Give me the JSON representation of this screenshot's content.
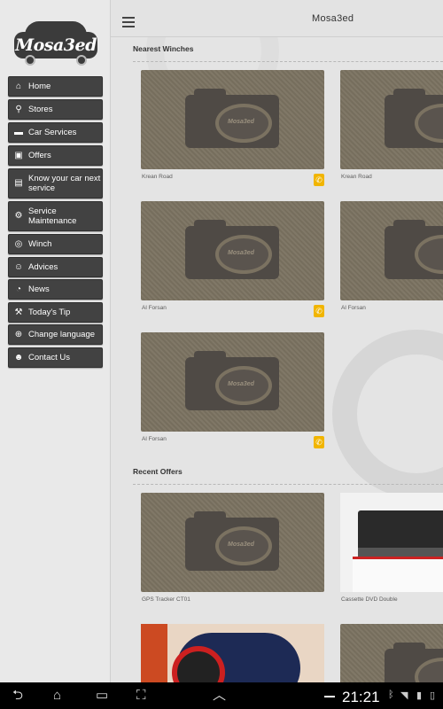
{
  "app": {
    "title": "Mosa3ed",
    "logo_text": "Mosa3ed"
  },
  "sidebar": {
    "items": [
      {
        "label": "Home",
        "icon": "home-icon",
        "glyph": "⌂"
      },
      {
        "label": "Stores",
        "icon": "map-pin-icon",
        "glyph": "⚲"
      },
      {
        "label": "Car Services",
        "icon": "car-icon",
        "glyph": "▬"
      },
      {
        "label": "Offers",
        "icon": "ticket-icon",
        "glyph": "▣"
      },
      {
        "label": "Know your car next service",
        "icon": "calculator-icon",
        "glyph": "▤"
      },
      {
        "label": "Service Maintenance",
        "icon": "gear-icon",
        "glyph": "⚙"
      },
      {
        "label": "Winch",
        "icon": "lifebuoy-icon",
        "glyph": "◎"
      },
      {
        "label": "Advices",
        "icon": "smiley-icon",
        "glyph": "☺"
      },
      {
        "label": "News",
        "icon": "rss-icon",
        "glyph": "◔"
      },
      {
        "label": "Today's Tip",
        "icon": "wrench-icon",
        "glyph": "⚒"
      },
      {
        "label": "Change language",
        "icon": "globe-icon",
        "glyph": "⊕"
      },
      {
        "label": "Contact Us",
        "icon": "contacts-icon",
        "glyph": "☻"
      }
    ]
  },
  "sections": {
    "nearest_winches": {
      "title": "Nearest Winches",
      "cards": [
        "Krean Road",
        "Krean Road",
        "Al Forsan",
        "Al Forsan",
        "Al Forsan"
      ]
    },
    "recent_offers": {
      "title": "Recent Offers",
      "cards": [
        "GPS Tracker CT01",
        "Cassette DVD Double"
      ]
    }
  },
  "placeholder_stamp": "Mosa3ed",
  "system_bar": {
    "time": "21:21",
    "nav": {
      "back": "back-icon",
      "home": "home-nav-icon",
      "recents": "recents-icon",
      "screenshot": "screenshot-icon",
      "menu": "menu-up-icon"
    }
  },
  "colors": {
    "menu_bg": "#424242",
    "phone_badge": "#f1b500",
    "placeholder_bg": "#7b7261",
    "camera": "#4f4a45"
  }
}
